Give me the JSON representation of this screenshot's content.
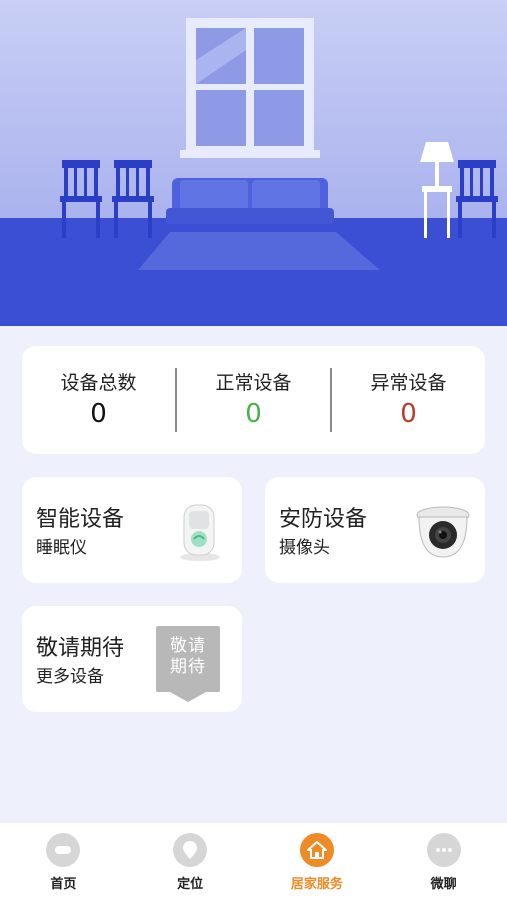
{
  "stats": [
    {
      "label": "设备总数",
      "value": "0",
      "color": "#111111"
    },
    {
      "label": "正常设备",
      "value": "0",
      "color": "#4caf50"
    },
    {
      "label": "异常设备",
      "value": "0",
      "color": "#c0392b"
    }
  ],
  "cards": {
    "smart": {
      "title": "智能设备",
      "sub": "睡眠仪",
      "icon": "sleep-monitor-device"
    },
    "security": {
      "title": "安防设备",
      "sub": "摄像头",
      "icon": "security-camera"
    },
    "more": {
      "title": "敬请期待",
      "sub": "更多设备",
      "badge": "敬请期待"
    }
  },
  "tabs": [
    {
      "label": "首页",
      "icon": "home-icon",
      "active": false
    },
    {
      "label": "定位",
      "icon": "location-pin-icon",
      "active": false
    },
    {
      "label": "居家服务",
      "icon": "house-icon",
      "active": true
    },
    {
      "label": "微聊",
      "icon": "chat-icon",
      "active": false
    }
  ],
  "colors": {
    "active": "#f08a24",
    "inactive_icon": "#d6d6d6",
    "hero_floor": "#3a4fd4",
    "hero_wall": "#b6bff0"
  }
}
